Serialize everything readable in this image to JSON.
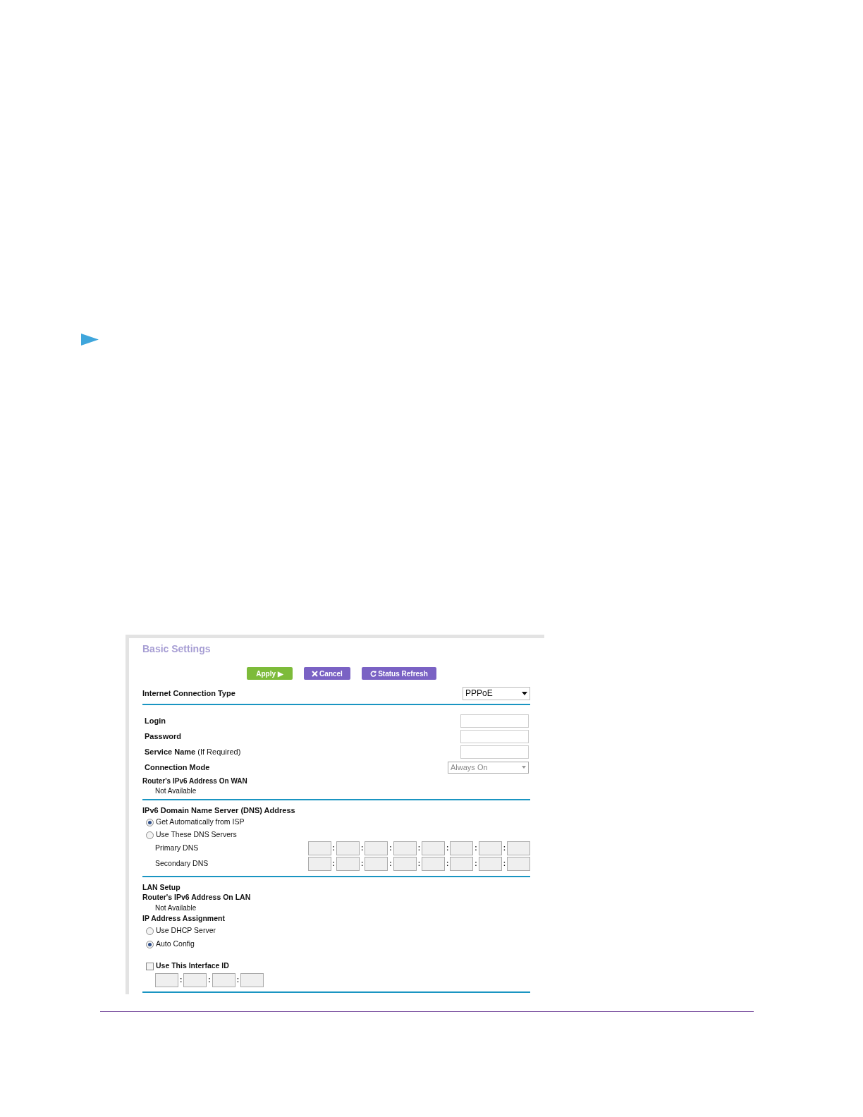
{
  "panel": {
    "title": "Basic Settings",
    "buttons": [
      {
        "kind": "apply",
        "label": "Apply ▶"
      },
      {
        "kind": "cancel",
        "label": "Cancel"
      },
      {
        "kind": "refresh",
        "label": "Status Refresh"
      }
    ],
    "connection_type": {
      "label": "Internet Connection Type",
      "value": "PPPoE"
    },
    "fields": [
      {
        "label": "Login"
      },
      {
        "label": "Password"
      },
      {
        "label": "Service Name",
        "hint": "(If Required)"
      }
    ],
    "connection_mode": {
      "label": "Connection Mode",
      "value": "Always On"
    },
    "wan_address": {
      "label": "Router's IPv6 Address On WAN",
      "value": "Not Available"
    },
    "dns": {
      "heading": "IPv6 Domain Name Server (DNS) Address",
      "options": [
        {
          "label": "Get Automatically from ISP",
          "selected": true
        },
        {
          "label": "Use These DNS Servers",
          "selected": false
        }
      ],
      "servers": [
        {
          "label": "Primary DNS",
          "separators": [
            ":",
            ":",
            ":",
            ":",
            ":",
            ":",
            ":"
          ]
        },
        {
          "label": "Secondary DNS",
          "separators": [
            ":",
            ":",
            ":",
            ":",
            ":",
            ":",
            ":"
          ]
        }
      ]
    },
    "lan": {
      "heading": "LAN Setup",
      "address_label": "Router's IPv6 Address On LAN",
      "address_value": "Not Available",
      "assignment_label": "IP Address Assignment",
      "options": [
        {
          "label": "Use DHCP Server",
          "selected": false
        },
        {
          "label": "Auto Config",
          "selected": true
        }
      ],
      "interface_id": {
        "label": "Use This Interface ID",
        "checked": false,
        "separators": [
          ":",
          ":",
          ":"
        ]
      }
    }
  }
}
